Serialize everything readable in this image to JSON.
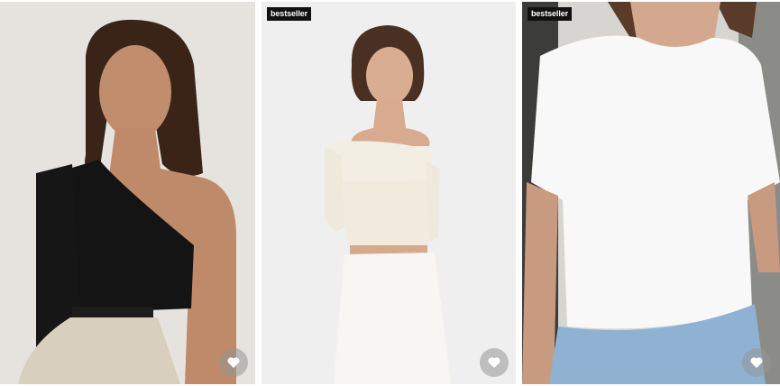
{
  "products": [
    {
      "image_alt": "Woman wearing black one-shoulder knit top with beige trousers",
      "badge": "",
      "favorite_icon": "heart-icon"
    },
    {
      "image_alt": "Woman wearing cream off-shoulder long sleeve top with white knit skirt",
      "badge": "bestseller",
      "favorite_icon": "heart-icon"
    },
    {
      "image_alt": "Woman wearing white crew neck t-shirt with light blue jeans",
      "badge": "bestseller",
      "favorite_icon": "heart-icon"
    }
  ],
  "colors": {
    "badge_bg": "#111111",
    "badge_text": "#ffffff",
    "favorite_bg": "#969696"
  }
}
